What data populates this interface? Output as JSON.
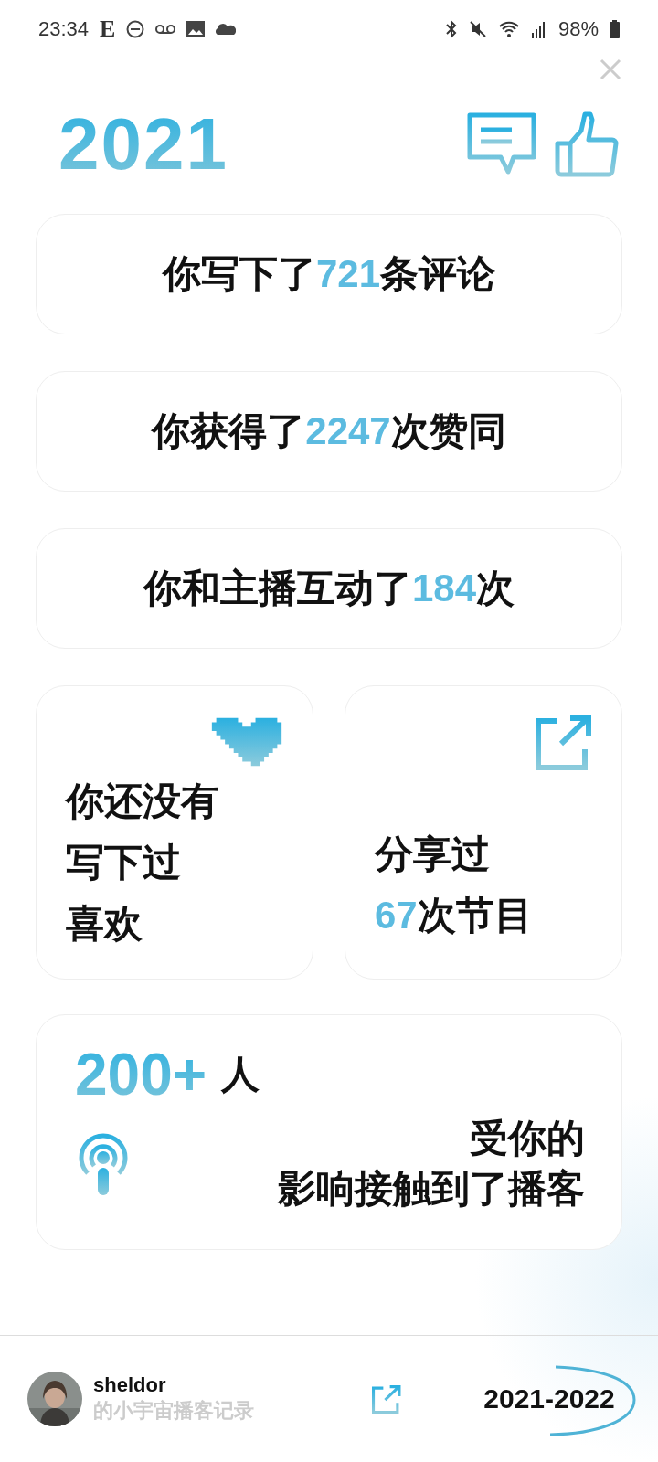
{
  "status_bar": {
    "time": "23:34",
    "app_letter": "E",
    "battery": "98%"
  },
  "header": {
    "year": "2021"
  },
  "stats": [
    {
      "parts": [
        {
          "text": "你写下了",
          "accent": false
        },
        {
          "text": "721",
          "accent": true
        },
        {
          "text": "条评论",
          "accent": false
        }
      ]
    },
    {
      "parts": [
        {
          "text": "你获得了",
          "accent": false
        },
        {
          "text": "2247",
          "accent": true
        },
        {
          "text": "次赞同",
          "accent": false
        }
      ]
    },
    {
      "parts": [
        {
          "text": "你和主播互动了",
          "accent": false
        },
        {
          "text": "184",
          "accent": true
        },
        {
          "text": "次",
          "accent": false
        }
      ]
    }
  ],
  "tiles": [
    {
      "kind": "heart",
      "lines": [
        [
          {
            "text": "你还没有",
            "accent": false
          }
        ],
        [
          {
            "text": "写下过",
            "accent": false
          }
        ],
        [
          {
            "text": "喜欢",
            "accent": false
          }
        ]
      ]
    },
    {
      "kind": "share",
      "lines": [
        [
          {
            "text": "分享过",
            "accent": false
          }
        ],
        [
          {
            "text": "67",
            "accent": true
          },
          {
            "text": "次节目",
            "accent": false
          }
        ]
      ]
    }
  ],
  "reach": {
    "count": "200+",
    "unit": "人",
    "lines": [
      "受你的",
      "影响接触到了播客"
    ]
  },
  "footer": {
    "username": "sheldor",
    "subtitle": "的小宇宙播客记录",
    "year_range": "2021-2022"
  }
}
